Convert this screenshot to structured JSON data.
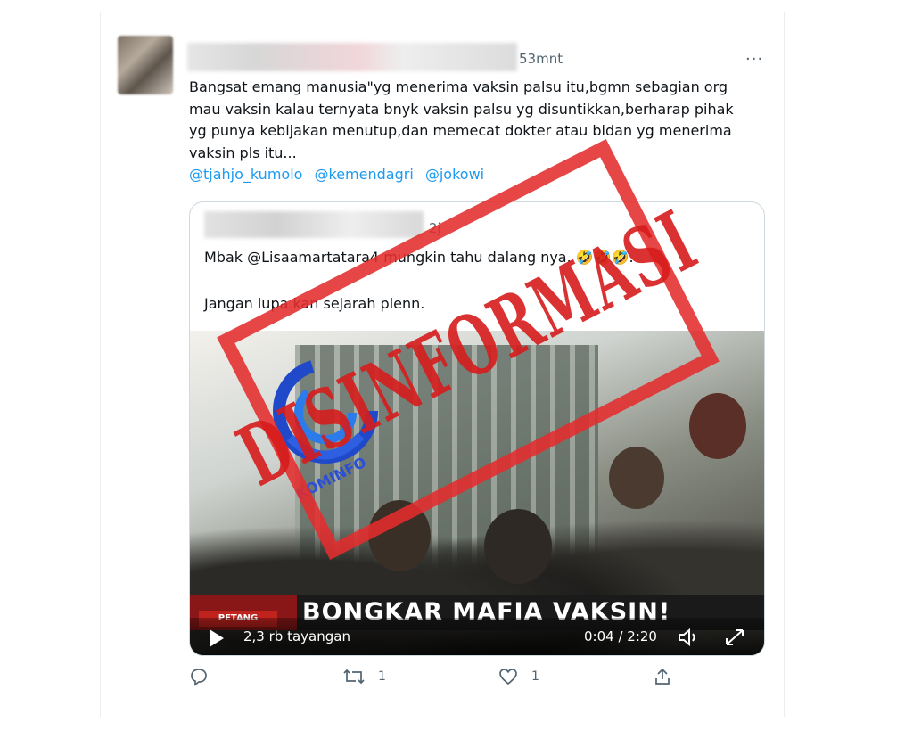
{
  "tweet": {
    "time": "53mnt",
    "more_icon": "more-dots-icon",
    "text": "Bangsat emang manusia\"yg menerima vaksin palsu itu,bgmn sebagian org\nmau vaksin kalau ternyata bnyk vaksin palsu yg disuntikkan,berharap pihak\nyg punya kebijakan menutup,dan memecat dokter atau bidan yg menerima\nvaksin pls itu...",
    "mentions": [
      "@tjahjo_kumolo",
      "@kemendagri",
      "@jokowi"
    ],
    "mention_color": "#1d9bf0"
  },
  "quote": {
    "time": "2j",
    "line1": "Mbak @Lisaamartatara4  mungkin tahu dalang nya. 🤣🤣🤣.",
    "line2": "Jangan lupa kan sejarah plenn.",
    "video": {
      "ticker_tag": "PETANG",
      "ticker": "BONGKAR MAFIA VAKSIN!",
      "views": "2,3 rb tayangan",
      "duration": "0:04 / 2:20",
      "play_icon": "play-icon",
      "volume_icon": "volume-icon",
      "fullscreen_icon": "fullscreen-icon"
    }
  },
  "overlay": {
    "stamp": "DISINFORMASI",
    "logo": "KOMINFO",
    "stamp_color": "#e42c2c"
  },
  "actions": {
    "reply_count": "",
    "retweet_count": "1",
    "like_count": "1"
  }
}
